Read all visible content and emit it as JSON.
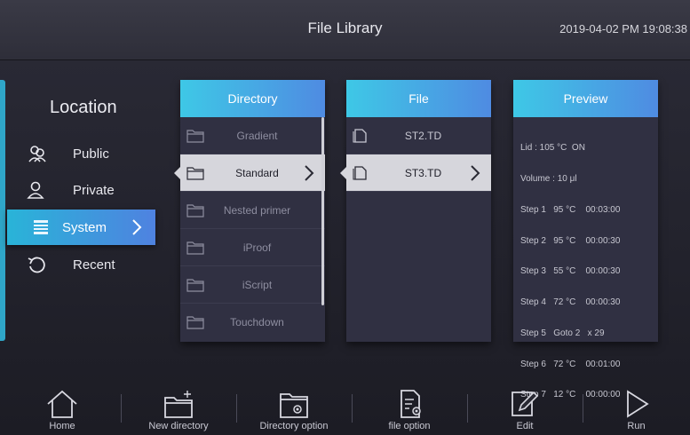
{
  "header": {
    "title": "File Library",
    "datetime": "2019-04-02 PM 19:08:38"
  },
  "location": {
    "title": "Location",
    "items": [
      {
        "label": "Public",
        "icon": "users-icon"
      },
      {
        "label": "Private",
        "icon": "user-icon"
      },
      {
        "label": "System",
        "icon": "list-icon",
        "selected": true
      },
      {
        "label": "Recent",
        "icon": "history-icon"
      }
    ]
  },
  "directory": {
    "header": "Directory",
    "items": [
      "Gradient",
      "Standard",
      "Nested primer",
      "iProof",
      "iScript",
      "Touchdown"
    ],
    "selected": "Standard"
  },
  "file": {
    "header": "File",
    "items": [
      "ST2.TD",
      "ST3.TD"
    ],
    "selected": "ST3.TD"
  },
  "preview": {
    "header": "Preview",
    "lines": [
      "Lid : 105 °C  ON",
      "Volume : 10 μl",
      "Step 1   95 °C    00:03:00",
      "Step 2   95 °C    00:00:30",
      "Step 3   55 °C    00:00:30",
      "Step 4   72 °C    00:00:30",
      "Step 5   Goto 2   x 29",
      "Step 6   72 °C    00:01:00",
      "Step 7   12 °C    00:00:00"
    ]
  },
  "toolbar": {
    "home": "Home",
    "new_directory": "New directory",
    "directory_option": "Directory option",
    "file_option": "file option",
    "edit": "Edit",
    "run": "Run"
  },
  "colors": {
    "accent_start": "#3ec8e6",
    "accent_end": "#4f8be2",
    "selected_row": "#d6d6dc"
  }
}
